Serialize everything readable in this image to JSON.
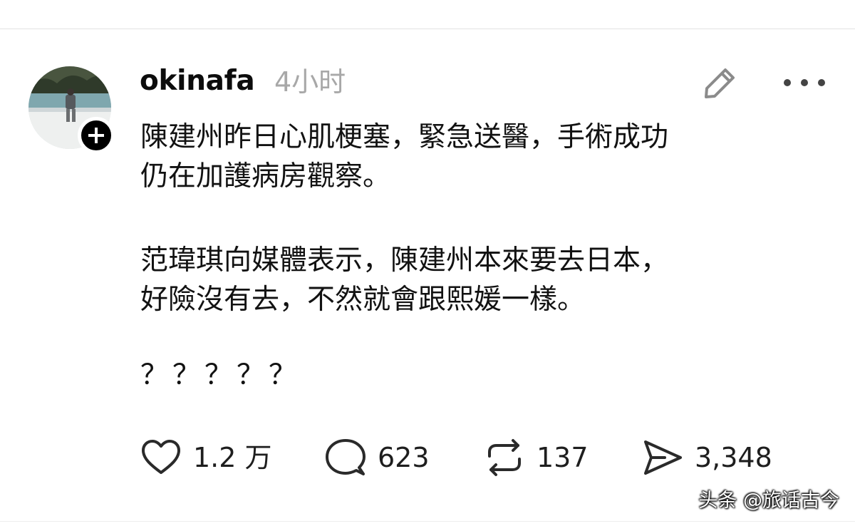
{
  "post": {
    "author": "okinafa",
    "time": "4小时",
    "paragraphs": [
      {
        "line1": "陳建州昨日心肌梗塞，緊急送醫，手術成功",
        "line2": "仍在加護病房觀察。"
      },
      {
        "line1": "范瑋琪向媒體表示，陳建州本來要去日本，",
        "line2": "好險沒有去，不然就會跟熙媛一樣。"
      },
      {
        "line1": "？？？？？"
      }
    ]
  },
  "actions": {
    "like_count": "1.2 万",
    "comment_count": "623",
    "repost_count": "137",
    "share_count": "3,348"
  },
  "watermark": "头条 @旅话古今",
  "icons": {
    "avatar": "avatar-photo",
    "follow": "plus-icon",
    "edit": "pencil-icon",
    "more": "more-horizontal-icon",
    "like": "heart-icon",
    "comment": "comment-bubble-icon",
    "repost": "repost-icon",
    "share": "send-icon"
  },
  "colors": {
    "background": "#ffffff",
    "text": "#121212",
    "muted": "#a8a8a8",
    "icon": "#2a2a2a"
  }
}
